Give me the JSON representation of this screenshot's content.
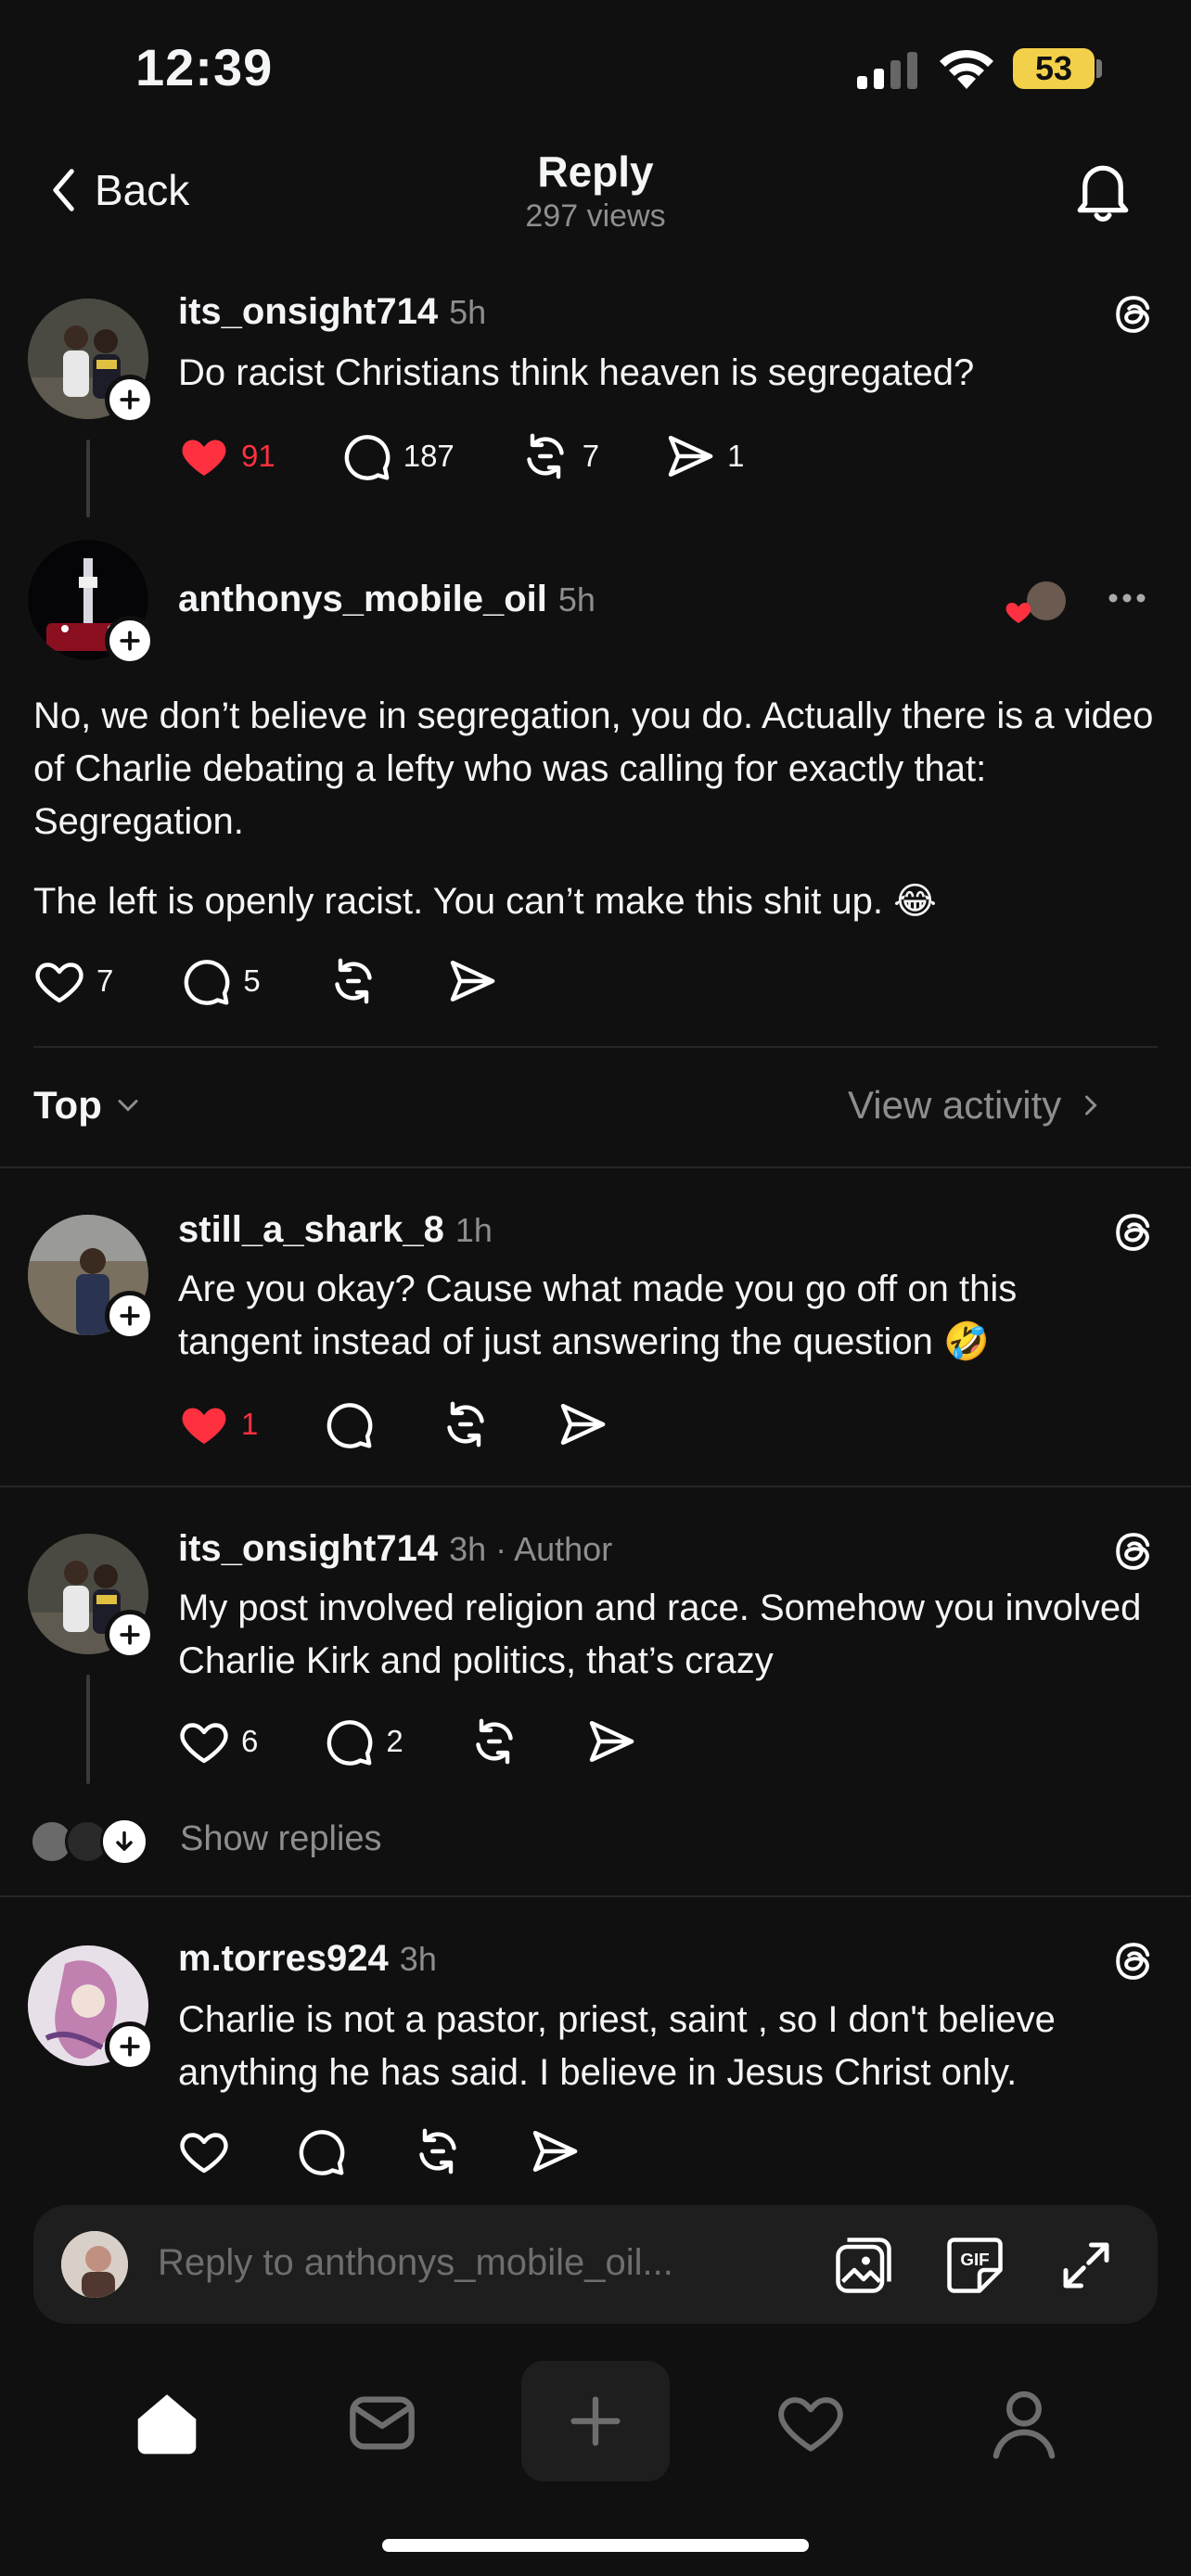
{
  "status_bar": {
    "time": "12:39",
    "battery": "53"
  },
  "header": {
    "back_label": "Back",
    "title": "Reply",
    "subtitle": "297 views"
  },
  "original_post": {
    "username": "its_onsight714",
    "time": "5h",
    "text": "Do racist Christians think heaven is segregated?",
    "likes": "91",
    "comments": "187",
    "reposts": "7",
    "shares": "1"
  },
  "focused_reply": {
    "username": "anthonys_mobile_oil",
    "time": "5h",
    "paragraph_1": "No, we don’t believe in segregation, you do. Actually there is a video of Charlie debating a lefty who was calling for exactly that: Segregation.",
    "paragraph_2": "The left is openly racist. You can’t make this shit up. 😂",
    "likes": "7",
    "comments": "5"
  },
  "sort": {
    "label": "Top",
    "view_activity": "View activity"
  },
  "replies": [
    {
      "username": "still_a_shark_8",
      "time": "1h",
      "text": "Are you okay? Cause what made you go off on this tangent instead of just answering the question 🤣",
      "likes": "1"
    },
    {
      "username": "its_onsight714",
      "time": "3h · Author",
      "text": "My post involved religion and race. Somehow you involved Charlie Kirk and politics, that’s crazy",
      "likes": "6",
      "comments": "2"
    },
    {
      "username": "m.torres924",
      "time": "3h",
      "text": "Charlie is not a pastor, priest, saint , so I don't believe anything he has said. I believe in Jesus Christ only."
    }
  ],
  "show_replies_label": "Show replies",
  "reply_bar": {
    "placeholder": "Reply to anthonys_mobile_oil..."
  },
  "icons": {
    "threads": "threads-icon",
    "like": "heart-icon",
    "comment": "comment-icon",
    "repost": "repost-icon",
    "share": "share-icon",
    "gif": "gif-icon",
    "image": "image-icon",
    "expand": "expand-icon"
  },
  "colors": {
    "background": "#101010",
    "like_red": "#ff3040",
    "muted": "#8e8e8e",
    "battery": "#f2d04a"
  }
}
